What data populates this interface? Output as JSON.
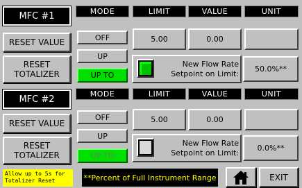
{
  "headers": {
    "mode": "MODE",
    "limit": "LIMIT",
    "value": "VALUE",
    "unit": "UNIT"
  },
  "mfc1": {
    "title": "MFC #1",
    "reset_value": "RESET VALUE",
    "reset_totalizer_line1": "RESET",
    "reset_totalizer_line2": "TOTALIZER",
    "mode_off": "OFF",
    "mode_up": "UP",
    "mode_up_to": "UP TO",
    "limit": "5.00",
    "value": "0.00",
    "unit": "",
    "indicator_state": "on",
    "setpoint_line1": "New Flow Rate",
    "setpoint_line2": "Setpoint on Limit:",
    "setpoint_value": "50.0%**"
  },
  "mfc2": {
    "title": "MFC #2",
    "reset_value": "RESET VALUE",
    "reset_totalizer_line1": "RESET",
    "reset_totalizer_line2": "TOTALIZER",
    "mode_off": "OFF",
    "mode_up": "UP",
    "mode_up_to": "UP TO",
    "limit": "5.00",
    "value": "0.00",
    "unit": "",
    "indicator_state": "off",
    "setpoint_line1": "New Flow Rate",
    "setpoint_line2": "Setpoint on Limit:",
    "setpoint_value": "0.0%**"
  },
  "notes": {
    "reset_note_line1": "Allow up to 5s for",
    "reset_note_line2": "Totalizer Reset",
    "range_note": "**Percent of Full Instrument Range"
  },
  "footer": {
    "home_icon": "home-icon",
    "exit": "EXIT"
  },
  "colors": {
    "active_green": "#00e000",
    "note_yellow": "#ffff00",
    "background": "#c0c0c0"
  }
}
